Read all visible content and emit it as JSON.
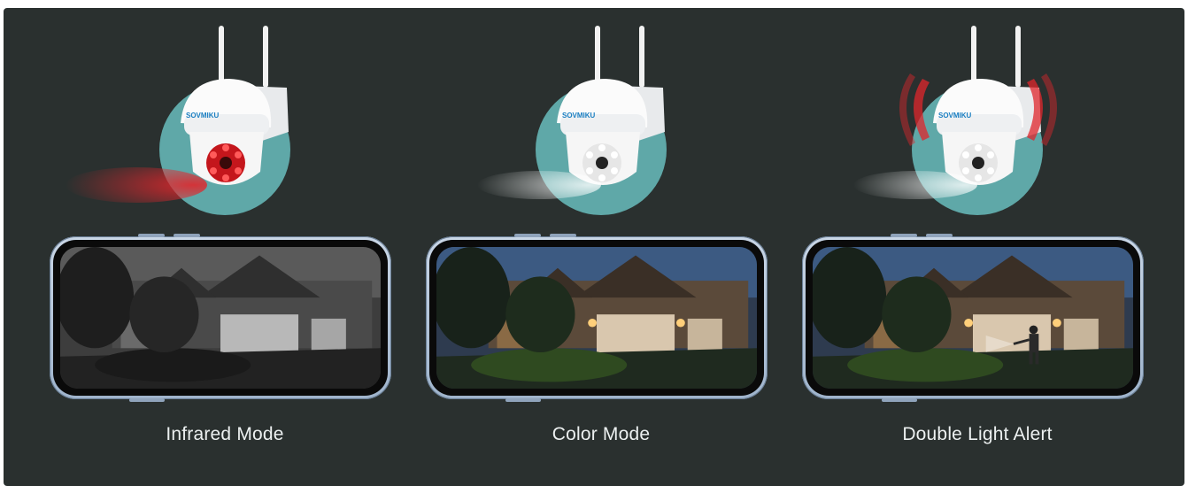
{
  "modes": [
    {
      "caption": "Infrared Mode",
      "led_color": "#e0262c",
      "scene": "grayscale"
    },
    {
      "caption": "Color Mode",
      "led_color": "#f4f4f4",
      "scene": "color"
    },
    {
      "caption": "Double Light Alert",
      "led_color": "#f4f4f4",
      "scene": "color-with-person"
    }
  ],
  "colors": {
    "background": "#2a302f",
    "accent_circle": "#5fa8a8",
    "infrared_red": "#e0262c",
    "caption_text": "#ecf0f0"
  },
  "brand_logo_text": "SOVMIKU"
}
